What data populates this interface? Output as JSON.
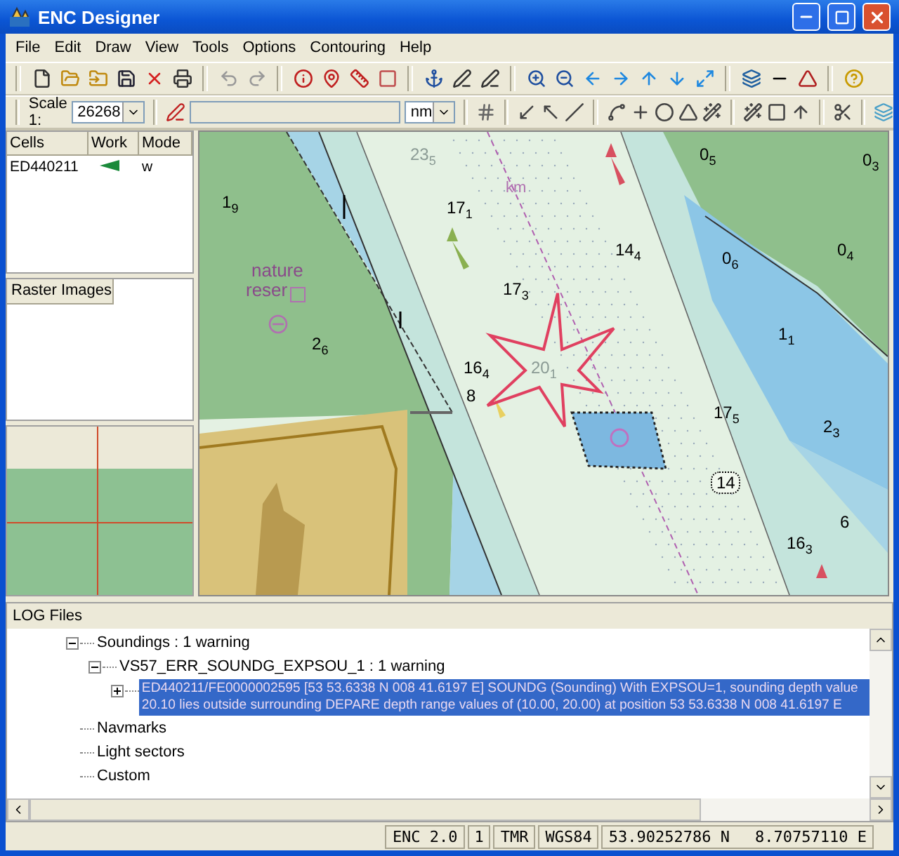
{
  "window": {
    "title": "ENC Designer"
  },
  "menu": [
    "File",
    "Edit",
    "Draw",
    "View",
    "Tools",
    "Options",
    "Contouring",
    "Help"
  ],
  "scale": {
    "label": "Scale 1:",
    "value": "26268"
  },
  "units": {
    "value": "nm"
  },
  "cells_table": {
    "columns": [
      "Cells",
      "Work",
      "Mode"
    ],
    "rows": [
      {
        "cell": "ED440211",
        "working": true,
        "mode": "w"
      }
    ]
  },
  "raster_panel": {
    "title": "Raster Images"
  },
  "map": {
    "labels": [
      {
        "kind": "faded",
        "text": "23$_{5}$"
      },
      {
        "kind": "sounding",
        "text": "1$_{9}$"
      },
      {
        "kind": "sounding",
        "text": "17$_{1}$"
      },
      {
        "kind": "route",
        "text": "km"
      },
      {
        "kind": "sounding",
        "text": "0$_{5}$"
      },
      {
        "kind": "sounding",
        "text": "0$_{3}$"
      },
      {
        "kind": "sounding",
        "text": "14$_{4}$"
      },
      {
        "kind": "sounding",
        "text": "0$_{6}$"
      },
      {
        "kind": "sounding",
        "text": "0$_{4}$"
      },
      {
        "kind": "place",
        "text": "nature"
      },
      {
        "kind": "place",
        "text": "reser"
      },
      {
        "kind": "sounding",
        "text": "17$_{3}$"
      },
      {
        "kind": "sounding",
        "text": "2$_{6}$"
      },
      {
        "kind": "sounding",
        "text": "1$_{1}$"
      },
      {
        "kind": "sounding",
        "text": "16$_{4}$"
      },
      {
        "kind": "faded",
        "text": "20$_{1}$"
      },
      {
        "kind": "sounding",
        "text": "8"
      },
      {
        "kind": "sounding",
        "text": "17$_{5}$"
      },
      {
        "kind": "sounding",
        "text": "2$_{3}$"
      },
      {
        "kind": "boxed",
        "text": "14"
      },
      {
        "kind": "sounding",
        "text": "6"
      },
      {
        "kind": "sounding",
        "text": "16$_{3}$"
      }
    ]
  },
  "log": {
    "title": "LOG Files",
    "tree": [
      {
        "label": "Soundings : 1 warning",
        "expanded": true,
        "selected": false,
        "children": [
          {
            "label": "VS57_ERR_SOUNDG_EXPSOU_1 : 1 warning",
            "expanded": true,
            "selected": false,
            "children": [
              {
                "label": "ED440211/FE0000002595 [53 53.6338 N 008 41.6197 E] SOUNDG (Sounding) With EXPSOU=1, sounding depth value 20.10 lies outside surrounding DEPARE depth range values of (10.00, 20.00) at position 53 53.6338 N  008 41.6197 E",
                "expanded": false,
                "selected": true
              }
            ]
          }
        ]
      },
      {
        "label": "Navmarks",
        "selected": false
      },
      {
        "label": "Light sectors",
        "selected": false
      },
      {
        "label": "Custom",
        "selected": false
      }
    ]
  },
  "status_bar": {
    "cells": [
      "ENC 2.0",
      "1",
      "TMR",
      "WGS84"
    ],
    "latitude": "53.90252786 N",
    "longitude": "8.70757110 E"
  }
}
